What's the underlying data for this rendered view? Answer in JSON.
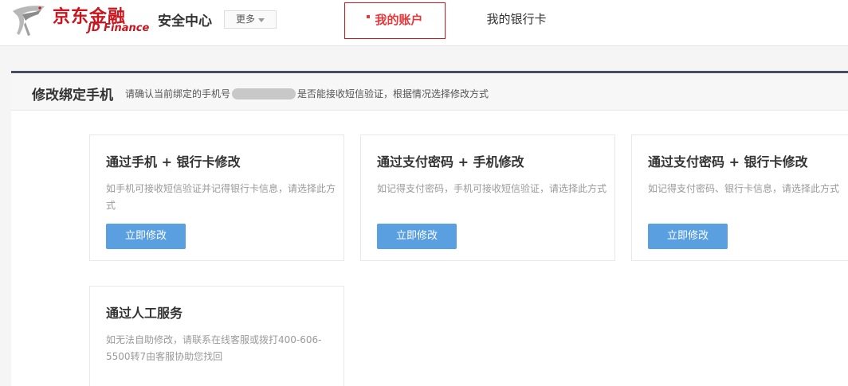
{
  "header": {
    "logo_cn": "京东金融",
    "logo_en": "JD Finance",
    "site_title": "安全中心",
    "more_label": "更多",
    "nav": [
      {
        "label": "我的账户",
        "active": true
      },
      {
        "label": "我的银行卡",
        "active": false
      }
    ]
  },
  "panel": {
    "title": "修改绑定手机",
    "desc_prefix": "请确认当前绑定的手机号",
    "desc_suffix": "是否能接收短信验证，根据情况选择修改方式"
  },
  "cards": [
    {
      "title": "通过手机 + 银行卡修改",
      "desc": "如手机可接收短信验证并记得银行卡信息，请选择此方式",
      "button": "立即修改"
    },
    {
      "title": "通过支付密码 + 手机修改",
      "desc": "如记得支付密码，手机可接收短信验证，请选择此方式",
      "button": "立即修改"
    },
    {
      "title": "通过支付密码 + 银行卡修改",
      "desc": "如记得支付密码、银行卡信息，请选择此方式",
      "button": "立即修改"
    },
    {
      "title": "通过人工服务",
      "desc": "如无法自助修改，请联系在线客服或拨打400-606-5500转7由客服协助您找回"
    }
  ],
  "colors": {
    "brand_red": "#c9151e",
    "panel_top": "#474d63",
    "button_blue": "#5a9fe0"
  }
}
